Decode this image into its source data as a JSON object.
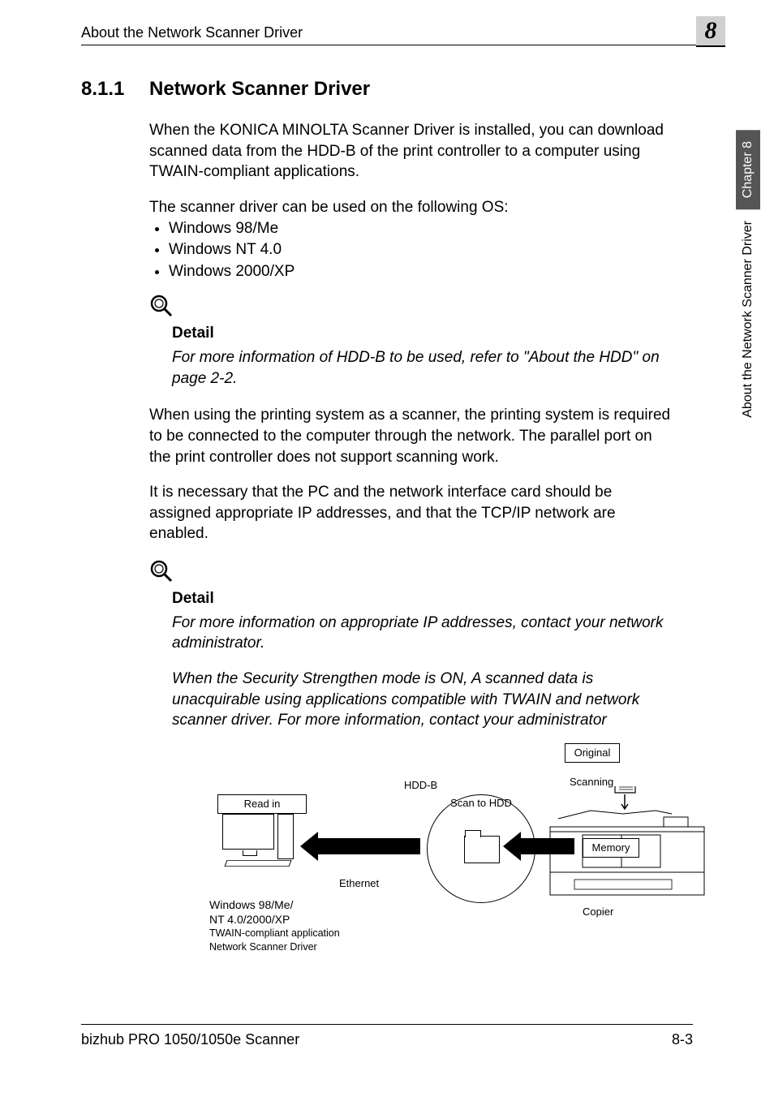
{
  "header": {
    "section_title": "About the Network Scanner Driver",
    "chapter_number": "8"
  },
  "side_tab": {
    "dark": "Chapter 8",
    "light": "About the Network Scanner Driver"
  },
  "heading": {
    "number": "8.1.1",
    "text": "Network Scanner Driver"
  },
  "paragraphs": {
    "p1": "When the KONICA MINOLTA Scanner Driver is installed, you can download scanned data from the HDD-B of the print controller to a computer using TWAIN-compliant applications.",
    "p2": "The scanner driver can be used on the following OS:",
    "p3": "When using the printing system as a scanner, the printing system is required to be connected to the computer through the network. The parallel port on the print controller does not support scanning work.",
    "p4": "It is necessary that the PC and the network interface card should be assigned appropriate IP addresses, and that the TCP/IP network are enabled."
  },
  "bullets": [
    "Windows 98/Me",
    "Windows NT 4.0",
    "Windows 2000/XP"
  ],
  "detail1": {
    "label": "Detail",
    "text": "For more information of HDD-B to be used, refer to \"About the HDD\" on page 2-2."
  },
  "detail2": {
    "label": "Detail",
    "text1": "For more information on appropriate IP addresses, contact your network administrator.",
    "text2": "When the Security Strengthen mode is ON, A scanned data is unacquirable using applications compatible with TWAIN and network scanner driver. For more information, contact your administrator"
  },
  "diagram": {
    "read_in": "Read in",
    "hddb": "HDD-B",
    "scan_to_hdd": "Scan to HDD",
    "original": "Original",
    "scanning": "Scanning",
    "memory": "Memory",
    "copier": "Copier",
    "ethernet": "Ethernet",
    "windows_line1": "Windows 98/Me/",
    "windows_line2": "NT 4.0/2000/XP",
    "windows_line3": "TWAIN-compliant application",
    "windows_line4": "Network Scanner Driver"
  },
  "footer": {
    "left": "bizhub PRO 1050/1050e Scanner",
    "right": "8-3"
  }
}
